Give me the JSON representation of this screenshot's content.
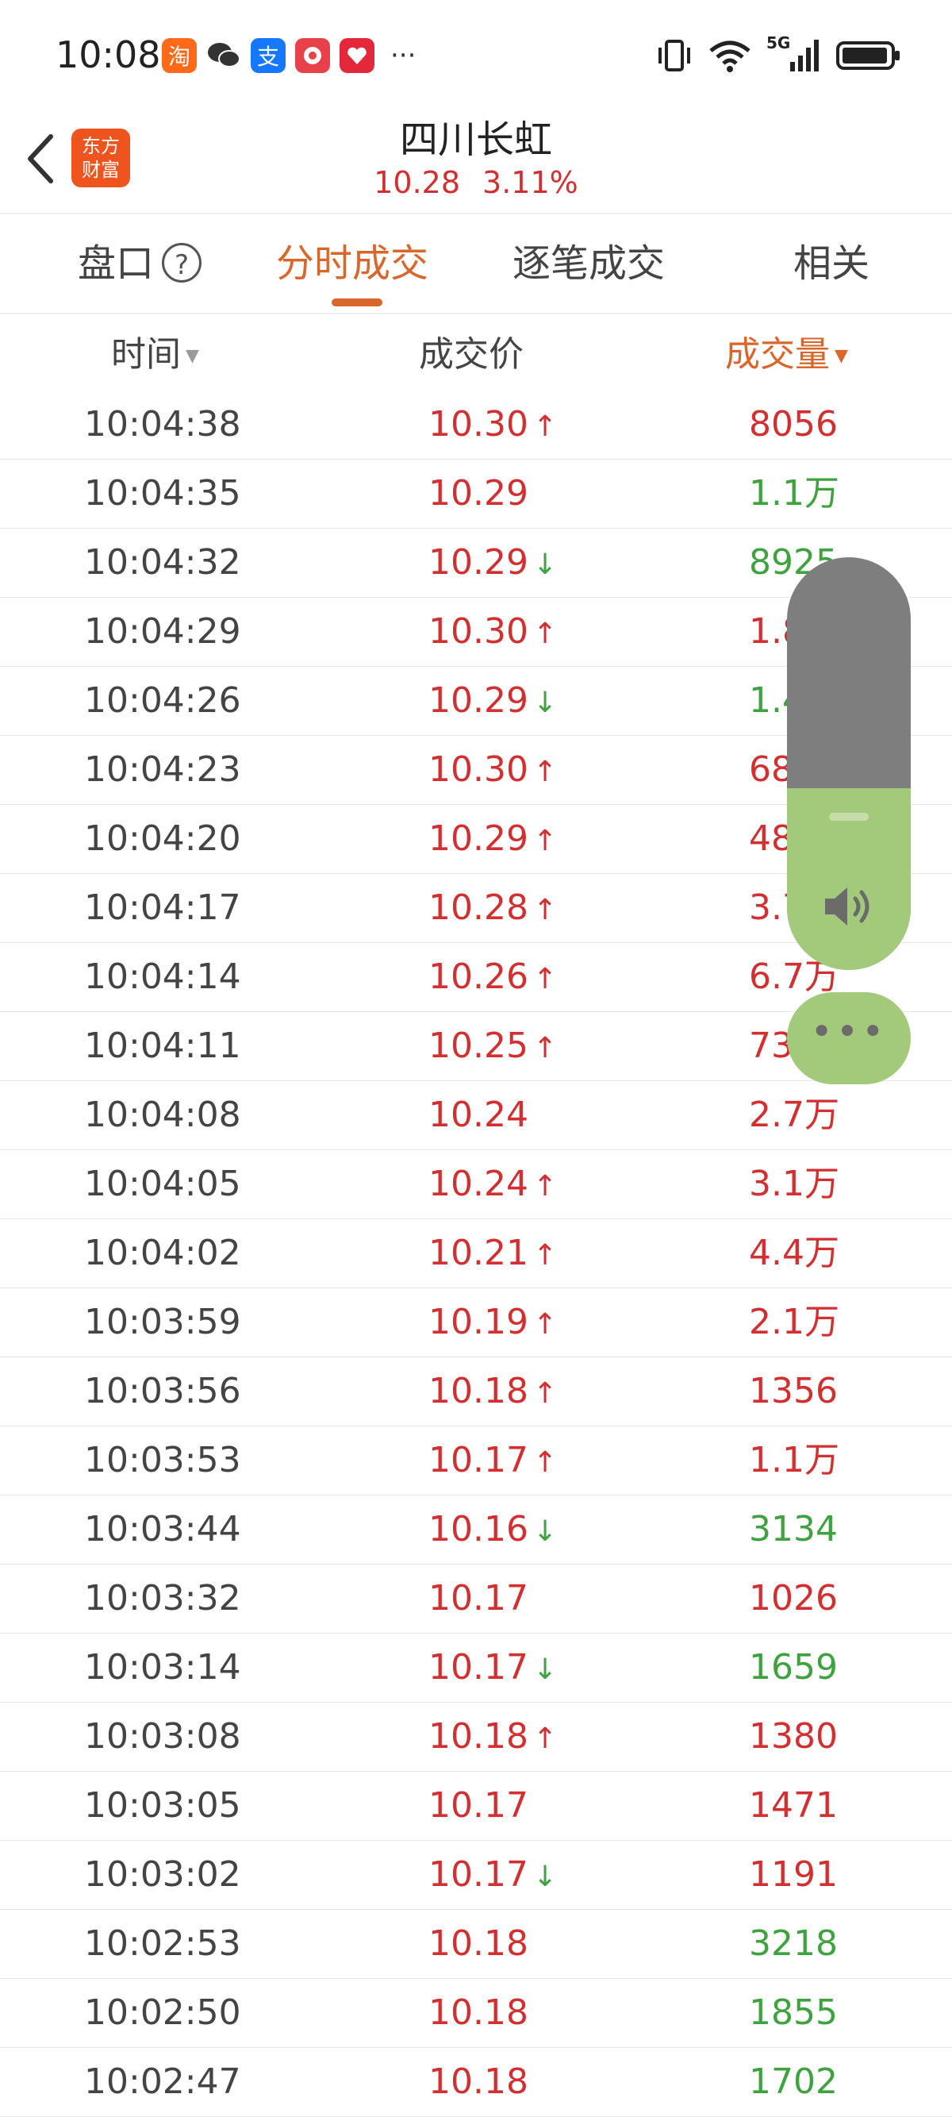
{
  "status_bar": {
    "time": "10:08",
    "app_icons": [
      {
        "name": "taobao-icon",
        "glyph": "淘",
        "color": "#ff6a1a"
      },
      {
        "name": "wechat-icon",
        "glyph": "",
        "color": "#ffffff"
      },
      {
        "name": "alipay-icon",
        "glyph": "支",
        "color": "#1677ff"
      },
      {
        "name": "app4-icon",
        "glyph": "",
        "color": "#e8414a"
      },
      {
        "name": "app5-icon",
        "glyph": "",
        "color": "#e3283a"
      }
    ],
    "more": "···",
    "network": "5G"
  },
  "header": {
    "title": "四川长虹",
    "price": "10.28",
    "change": "3.11%",
    "logo_line1": "东方",
    "logo_line2": "财富"
  },
  "tabs": [
    {
      "label": "盘口",
      "active": false
    },
    {
      "label": "分时成交",
      "active": true
    },
    {
      "label": "逐笔成交",
      "active": false
    },
    {
      "label": "相关",
      "active": false
    }
  ],
  "help_glyph": "?",
  "columns": {
    "time": "时间",
    "price": "成交价",
    "volume": "成交量",
    "sort_glyph": "▼"
  },
  "colors": {
    "up": "#d23030",
    "down": "#3ea33e",
    "accent": "#d9662a"
  },
  "trades": [
    {
      "time": "10:04:38",
      "price": "10.30",
      "dir": "up",
      "vol": "8056",
      "vol_color": "red"
    },
    {
      "time": "10:04:35",
      "price": "10.29",
      "dir": "",
      "vol": "1.1万",
      "vol_color": "green"
    },
    {
      "time": "10:04:32",
      "price": "10.29",
      "dir": "down",
      "vol": "8925",
      "vol_color": "green"
    },
    {
      "time": "10:04:29",
      "price": "10.30",
      "dir": "up",
      "vol": "1.8",
      "vol_color": "red"
    },
    {
      "time": "10:04:26",
      "price": "10.29",
      "dir": "down",
      "vol": "1.4",
      "vol_color": "green"
    },
    {
      "time": "10:04:23",
      "price": "10.30",
      "dir": "up",
      "vol": "68",
      "vol_color": "red"
    },
    {
      "time": "10:04:20",
      "price": "10.29",
      "dir": "up",
      "vol": "48",
      "vol_color": "red"
    },
    {
      "time": "10:04:17",
      "price": "10.28",
      "dir": "up",
      "vol": "3.7",
      "vol_color": "red"
    },
    {
      "time": "10:04:14",
      "price": "10.26",
      "dir": "up",
      "vol": "6.7万",
      "vol_color": "red"
    },
    {
      "time": "10:04:11",
      "price": "10.25",
      "dir": "up",
      "vol": "73",
      "vol_color": "red"
    },
    {
      "time": "10:04:08",
      "price": "10.24",
      "dir": "",
      "vol": "2.7万",
      "vol_color": "red"
    },
    {
      "time": "10:04:05",
      "price": "10.24",
      "dir": "up",
      "vol": "3.1万",
      "vol_color": "red"
    },
    {
      "time": "10:04:02",
      "price": "10.21",
      "dir": "up",
      "vol": "4.4万",
      "vol_color": "red"
    },
    {
      "time": "10:03:59",
      "price": "10.19",
      "dir": "up",
      "vol": "2.1万",
      "vol_color": "red"
    },
    {
      "time": "10:03:56",
      "price": "10.18",
      "dir": "up",
      "vol": "1356",
      "vol_color": "red"
    },
    {
      "time": "10:03:53",
      "price": "10.17",
      "dir": "up",
      "vol": "1.1万",
      "vol_color": "red"
    },
    {
      "time": "10:03:44",
      "price": "10.16",
      "dir": "down",
      "vol": "3134",
      "vol_color": "green"
    },
    {
      "time": "10:03:32",
      "price": "10.17",
      "dir": "",
      "vol": "1026",
      "vol_color": "red"
    },
    {
      "time": "10:03:14",
      "price": "10.17",
      "dir": "down",
      "vol": "1659",
      "vol_color": "green"
    },
    {
      "time": "10:03:08",
      "price": "10.18",
      "dir": "up",
      "vol": "1380",
      "vol_color": "red"
    },
    {
      "time": "10:03:05",
      "price": "10.17",
      "dir": "",
      "vol": "1471",
      "vol_color": "red"
    },
    {
      "time": "10:03:02",
      "price": "10.17",
      "dir": "down",
      "vol": "1191",
      "vol_color": "red"
    },
    {
      "time": "10:02:53",
      "price": "10.18",
      "dir": "",
      "vol": "3218",
      "vol_color": "green"
    },
    {
      "time": "10:02:50",
      "price": "10.18",
      "dir": "",
      "vol": "1855",
      "vol_color": "green"
    },
    {
      "time": "10:02:47",
      "price": "10.18",
      "dir": "",
      "vol": "1702",
      "vol_color": "green"
    }
  ],
  "volume_widget": {
    "level": 0.44,
    "more_glyph": "•••"
  }
}
